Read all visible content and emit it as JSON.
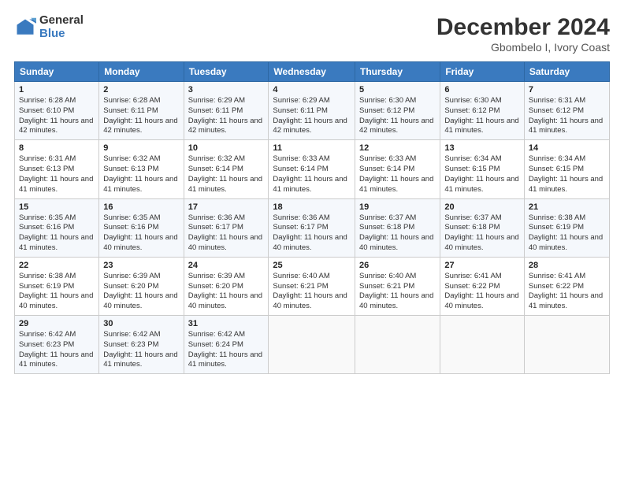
{
  "logo": {
    "general": "General",
    "blue": "Blue"
  },
  "header": {
    "month": "December 2024",
    "location": "Gbombelo I, Ivory Coast"
  },
  "weekdays": [
    "Sunday",
    "Monday",
    "Tuesday",
    "Wednesday",
    "Thursday",
    "Friday",
    "Saturday"
  ],
  "weeks": [
    [
      {
        "day": "1",
        "sunrise": "6:28 AM",
        "sunset": "6:10 PM",
        "daylight": "11 hours and 42 minutes"
      },
      {
        "day": "2",
        "sunrise": "6:28 AM",
        "sunset": "6:11 PM",
        "daylight": "11 hours and 42 minutes"
      },
      {
        "day": "3",
        "sunrise": "6:29 AM",
        "sunset": "6:11 PM",
        "daylight": "11 hours and 42 minutes"
      },
      {
        "day": "4",
        "sunrise": "6:29 AM",
        "sunset": "6:11 PM",
        "daylight": "11 hours and 42 minutes"
      },
      {
        "day": "5",
        "sunrise": "6:30 AM",
        "sunset": "6:12 PM",
        "daylight": "11 hours and 42 minutes"
      },
      {
        "day": "6",
        "sunrise": "6:30 AM",
        "sunset": "6:12 PM",
        "daylight": "11 hours and 41 minutes"
      },
      {
        "day": "7",
        "sunrise": "6:31 AM",
        "sunset": "6:12 PM",
        "daylight": "11 hours and 41 minutes"
      }
    ],
    [
      {
        "day": "8",
        "sunrise": "6:31 AM",
        "sunset": "6:13 PM",
        "daylight": "11 hours and 41 minutes"
      },
      {
        "day": "9",
        "sunrise": "6:32 AM",
        "sunset": "6:13 PM",
        "daylight": "11 hours and 41 minutes"
      },
      {
        "day": "10",
        "sunrise": "6:32 AM",
        "sunset": "6:14 PM",
        "daylight": "11 hours and 41 minutes"
      },
      {
        "day": "11",
        "sunrise": "6:33 AM",
        "sunset": "6:14 PM",
        "daylight": "11 hours and 41 minutes"
      },
      {
        "day": "12",
        "sunrise": "6:33 AM",
        "sunset": "6:14 PM",
        "daylight": "11 hours and 41 minutes"
      },
      {
        "day": "13",
        "sunrise": "6:34 AM",
        "sunset": "6:15 PM",
        "daylight": "11 hours and 41 minutes"
      },
      {
        "day": "14",
        "sunrise": "6:34 AM",
        "sunset": "6:15 PM",
        "daylight": "11 hours and 41 minutes"
      }
    ],
    [
      {
        "day": "15",
        "sunrise": "6:35 AM",
        "sunset": "6:16 PM",
        "daylight": "11 hours and 41 minutes"
      },
      {
        "day": "16",
        "sunrise": "6:35 AM",
        "sunset": "6:16 PM",
        "daylight": "11 hours and 40 minutes"
      },
      {
        "day": "17",
        "sunrise": "6:36 AM",
        "sunset": "6:17 PM",
        "daylight": "11 hours and 40 minutes"
      },
      {
        "day": "18",
        "sunrise": "6:36 AM",
        "sunset": "6:17 PM",
        "daylight": "11 hours and 40 minutes"
      },
      {
        "day": "19",
        "sunrise": "6:37 AM",
        "sunset": "6:18 PM",
        "daylight": "11 hours and 40 minutes"
      },
      {
        "day": "20",
        "sunrise": "6:37 AM",
        "sunset": "6:18 PM",
        "daylight": "11 hours and 40 minutes"
      },
      {
        "day": "21",
        "sunrise": "6:38 AM",
        "sunset": "6:19 PM",
        "daylight": "11 hours and 40 minutes"
      }
    ],
    [
      {
        "day": "22",
        "sunrise": "6:38 AM",
        "sunset": "6:19 PM",
        "daylight": "11 hours and 40 minutes"
      },
      {
        "day": "23",
        "sunrise": "6:39 AM",
        "sunset": "6:20 PM",
        "daylight": "11 hours and 40 minutes"
      },
      {
        "day": "24",
        "sunrise": "6:39 AM",
        "sunset": "6:20 PM",
        "daylight": "11 hours and 40 minutes"
      },
      {
        "day": "25",
        "sunrise": "6:40 AM",
        "sunset": "6:21 PM",
        "daylight": "11 hours and 40 minutes"
      },
      {
        "day": "26",
        "sunrise": "6:40 AM",
        "sunset": "6:21 PM",
        "daylight": "11 hours and 40 minutes"
      },
      {
        "day": "27",
        "sunrise": "6:41 AM",
        "sunset": "6:22 PM",
        "daylight": "11 hours and 40 minutes"
      },
      {
        "day": "28",
        "sunrise": "6:41 AM",
        "sunset": "6:22 PM",
        "daylight": "11 hours and 41 minutes"
      }
    ],
    [
      {
        "day": "29",
        "sunrise": "6:42 AM",
        "sunset": "6:23 PM",
        "daylight": "11 hours and 41 minutes"
      },
      {
        "day": "30",
        "sunrise": "6:42 AM",
        "sunset": "6:23 PM",
        "daylight": "11 hours and 41 minutes"
      },
      {
        "day": "31",
        "sunrise": "6:42 AM",
        "sunset": "6:24 PM",
        "daylight": "11 hours and 41 minutes"
      },
      null,
      null,
      null,
      null
    ]
  ]
}
